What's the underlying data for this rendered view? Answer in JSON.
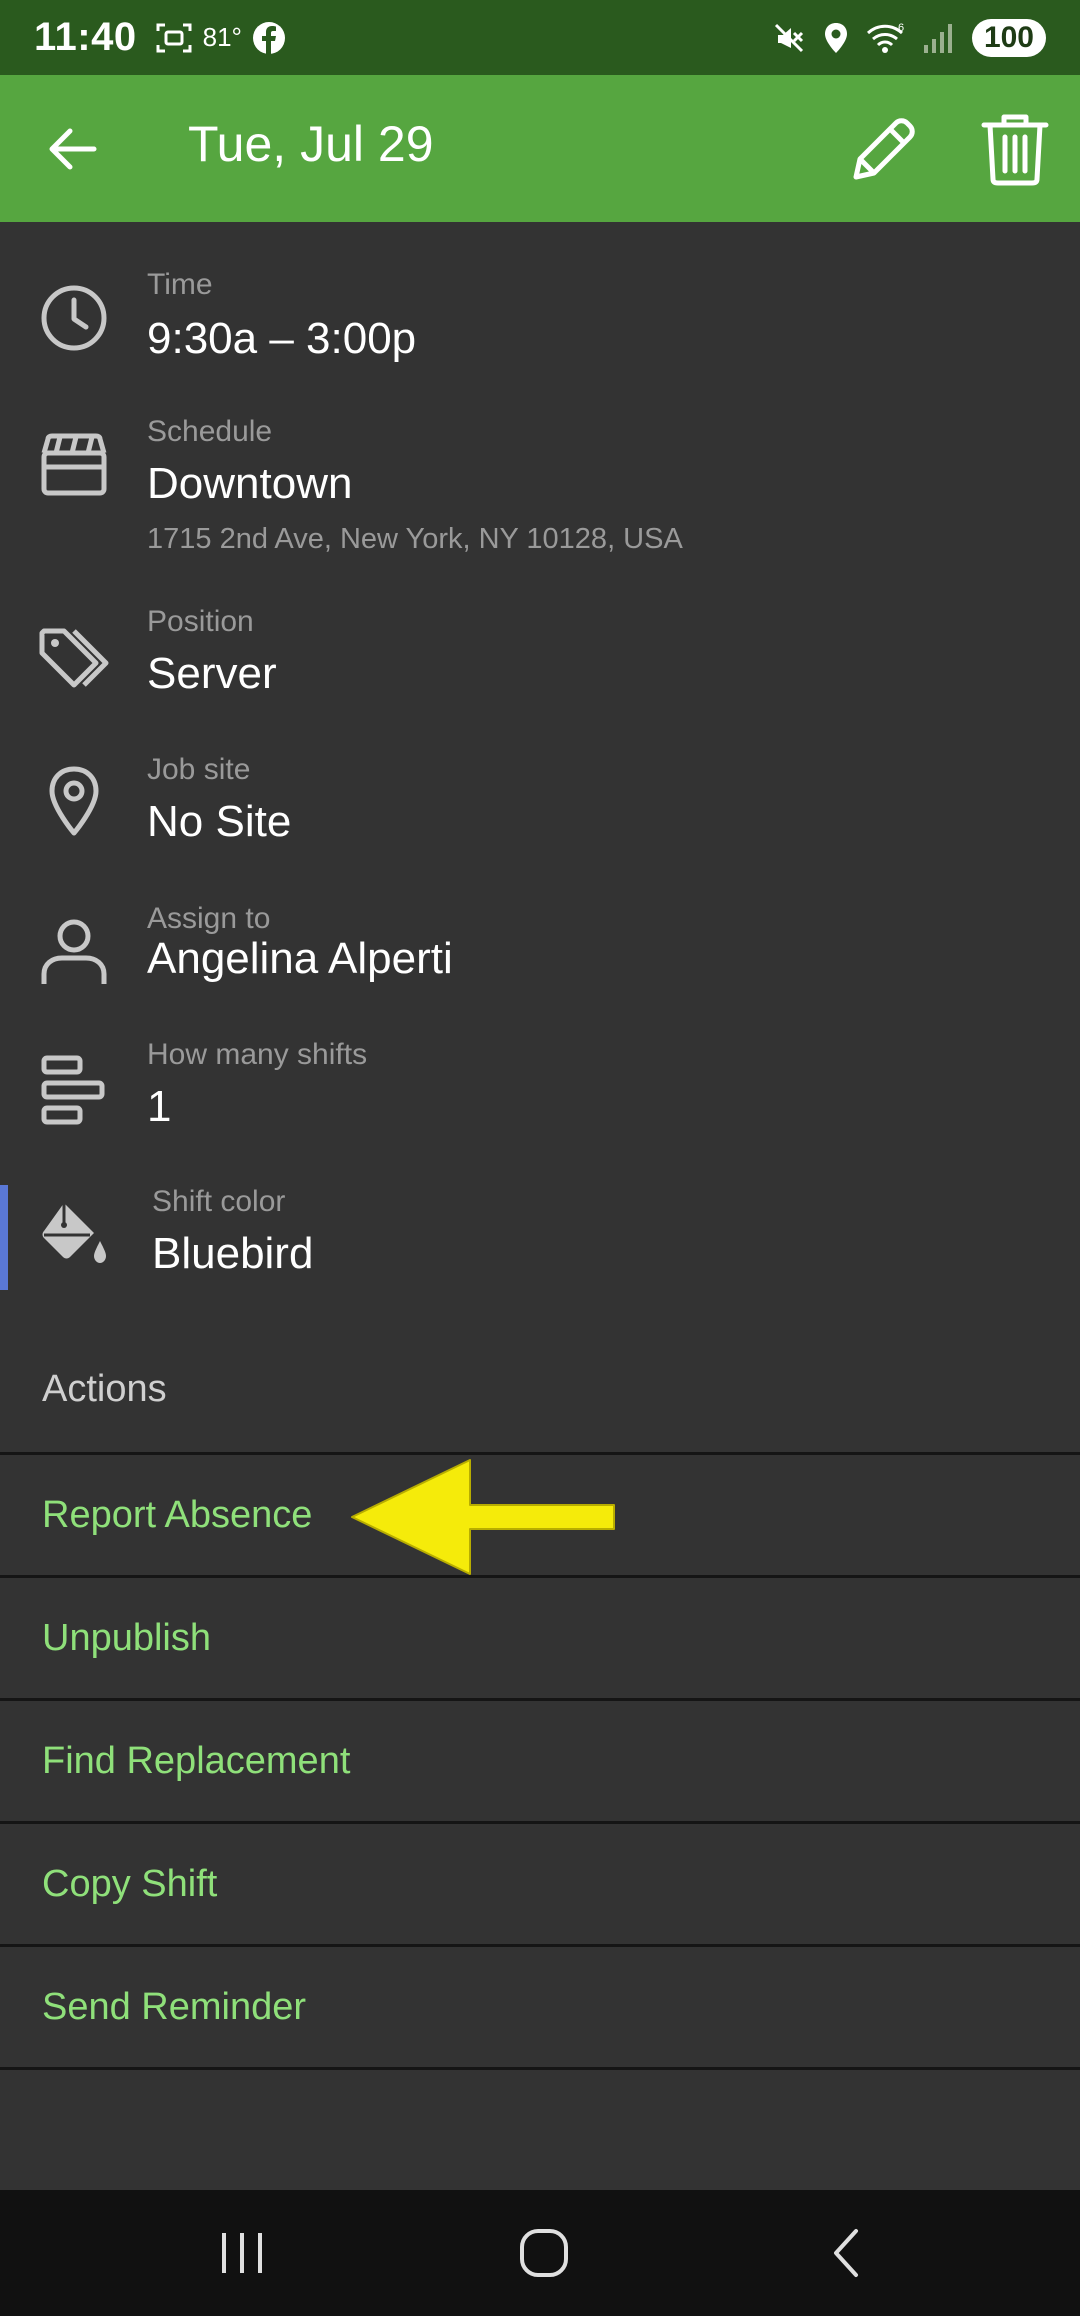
{
  "status_bar": {
    "time": "11:40",
    "temperature": "81°",
    "battery": "100",
    "icons": [
      "screenshot-icon",
      "facebook-icon",
      "mute-icon",
      "location-icon",
      "wifi-icon",
      "signal-icon"
    ]
  },
  "app_bar": {
    "title": "Tue, Jul 29",
    "background": "#56a640",
    "icons": [
      "back-arrow-icon",
      "pencil-icon",
      "trash-icon"
    ]
  },
  "details": {
    "time": {
      "label": "Time",
      "value": "9:30a – 3:00p",
      "icon": "clock-icon"
    },
    "schedule": {
      "label": "Schedule",
      "value": "Downtown",
      "address": "1715 2nd Ave, New York, NY 10128, USA",
      "icon": "clapperboard-icon"
    },
    "position": {
      "label": "Position",
      "value": "Server",
      "icon": "tags-icon"
    },
    "job_site": {
      "label": "Job site",
      "value": "No Site",
      "icon": "map-pin-icon"
    },
    "assign_to": {
      "label": "Assign to",
      "value": "Angelina Alperti",
      "icon": "person-icon"
    },
    "shifts": {
      "label": "How many shifts",
      "value": "1",
      "icon": "bars-icon"
    },
    "shift_color": {
      "label": "Shift color",
      "value": "Bluebird",
      "color": "#5a78d6",
      "icon": "paint-bucket-icon"
    }
  },
  "actions": {
    "heading": "Actions",
    "items": [
      "Report Absence",
      "Unpublish",
      "Find Replacement",
      "Copy Shift",
      "Send Reminder"
    ],
    "text_color": "#8fe07a"
  },
  "annotation": {
    "arrow_color": "#f5eb0a"
  },
  "nav_bar": {
    "icons": [
      "recents-icon",
      "home-icon",
      "back-icon"
    ]
  }
}
